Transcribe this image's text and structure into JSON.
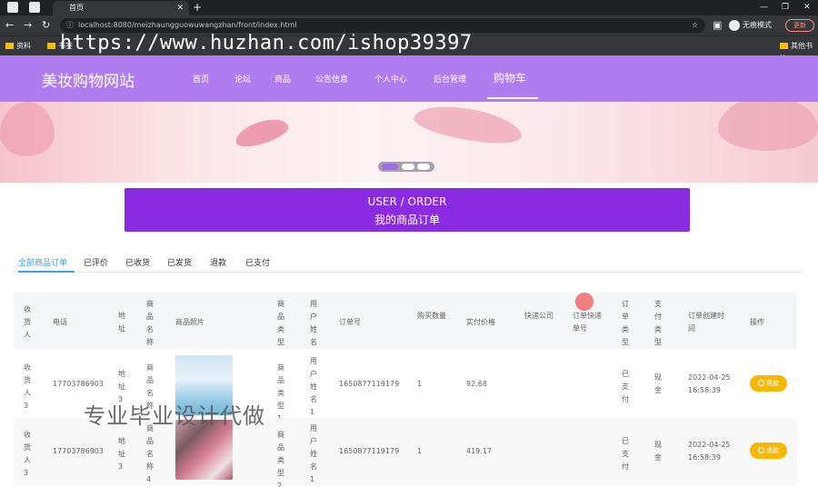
{
  "browser": {
    "tab_title": "首页",
    "url": "localhost:8080/meizhaungguowuwangzhan/front/index.html",
    "incognito_label": "无痕模式",
    "update_label": "更新",
    "bookmarks": [
      "资料",
      "书签",
      "其他书签"
    ],
    "watermark_url": "https://www.huzhan.com/ishop39397"
  },
  "site": {
    "title": "美妆购物网站",
    "nav": [
      "首页",
      "论坛",
      "商品",
      "公告信息",
      "个人中心",
      "后台管理",
      "购物车"
    ]
  },
  "order_banner": {
    "en": "USER / ORDER",
    "cn": "我的商品订单"
  },
  "tabs": [
    "全部商品订单",
    "已评价",
    "已收货",
    "已发货",
    "退款",
    "已支付"
  ],
  "table": {
    "headers": [
      "收货人",
      "电话",
      "地址",
      "商品名称",
      "商品照片",
      "商品类型",
      "用户姓名",
      "订单号",
      "购买数量",
      "实付价格",
      "快递公司",
      "订单快递单号",
      "订单类型",
      "支付类型",
      "订单创建时间",
      "操作"
    ],
    "rows": [
      {
        "receiver": "收货人3",
        "phone": "17703786903",
        "address": "地址3",
        "product": "商品名称",
        "type": "商品类型1",
        "user": "用户姓名1",
        "order_no": "1650877119179",
        "qty": "1",
        "price": "92.68",
        "order_type": "已支付",
        "pay_type": "现金",
        "created": "2022-04-25 16:58:39",
        "action": "退款"
      },
      {
        "receiver": "收货人3",
        "phone": "17703786903",
        "address": "地址3",
        "product": "商品名称4",
        "type": "商品类型2",
        "user": "用户姓名1",
        "order_no": "1650877119179",
        "qty": "1",
        "price": "419.17",
        "order_type": "已支付",
        "pay_type": "现金",
        "created": "2022-04-25 16:58:39",
        "action": "退款"
      }
    ]
  },
  "overlay_text": "专业毕业设计代做",
  "colors": {
    "header": "#b07df0",
    "order_banner": "#8a2be2",
    "tab_active": "#409eff",
    "refund": "#f6b800"
  }
}
